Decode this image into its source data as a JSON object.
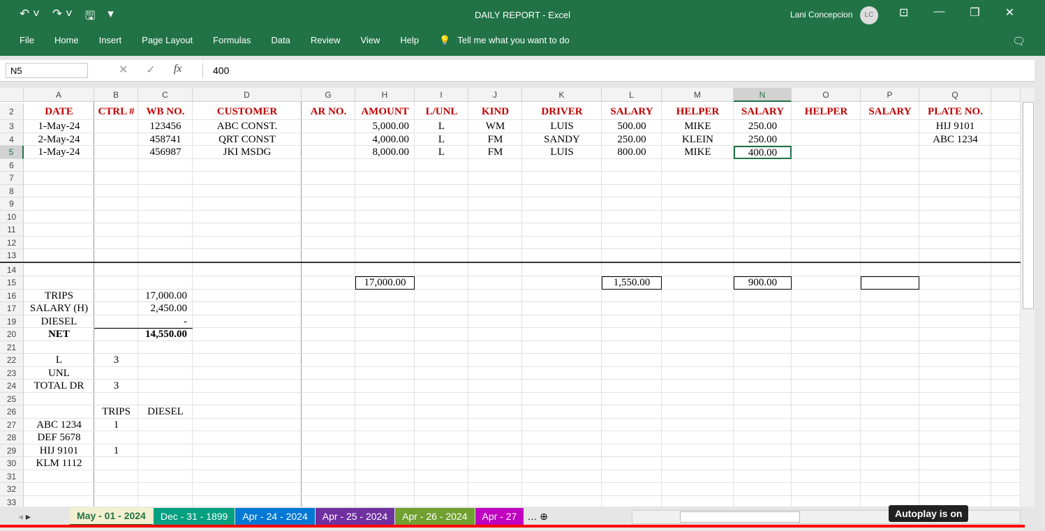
{
  "titlebar": {
    "title": "DAILY REPORT  -  Excel",
    "user": "Lani Concepcion",
    "initials": "LC"
  },
  "menu": [
    "File",
    "Home",
    "Insert",
    "Page Layout",
    "Formulas",
    "Data",
    "Review",
    "View",
    "Help"
  ],
  "tell_me": "Tell me what you want to do",
  "formula_bar": {
    "name_box": "N5",
    "value": "400"
  },
  "columns": [
    [
      "A",
      101
    ],
    [
      "B",
      63
    ],
    [
      "C",
      78
    ],
    [
      "D",
      156
    ],
    [
      "G",
      77
    ],
    [
      "H",
      85
    ],
    [
      "I",
      77
    ],
    [
      "J",
      77
    ],
    [
      "K",
      114
    ],
    [
      "L",
      86
    ],
    [
      "M",
      103
    ],
    [
      "N",
      83
    ],
    [
      "O",
      99
    ],
    [
      "P",
      84
    ],
    [
      "Q",
      103
    ],
    [
      "",
      42
    ]
  ],
  "selected_col": "N",
  "selected_row": "5",
  "rows": [
    "2",
    "3",
    "4",
    "5",
    "6",
    "7",
    "8",
    "9",
    "10",
    "11",
    "12",
    "13",
    "14",
    "15",
    "16",
    "17",
    "19",
    "20",
    "21",
    "22",
    "23",
    "24",
    "25",
    "26",
    "27",
    "28",
    "29",
    "30",
    "31",
    "32",
    "33"
  ],
  "cells": [
    [
      "2",
      "A",
      "DATE",
      "hdr"
    ],
    [
      "2",
      "B",
      "CTRL #",
      "hdr"
    ],
    [
      "2",
      "C",
      "WB NO.",
      "hdr"
    ],
    [
      "2",
      "D",
      "CUSTOMER",
      "hdr"
    ],
    [
      "2",
      "G",
      "AR NO.",
      "hdr"
    ],
    [
      "2",
      "H",
      "AMOUNT",
      "hdr"
    ],
    [
      "2",
      "I",
      "L/UNL",
      "hdr"
    ],
    [
      "2",
      "J",
      "KIND",
      "hdr"
    ],
    [
      "2",
      "K",
      "DRIVER",
      "hdr"
    ],
    [
      "2",
      "L",
      "SALARY",
      "hdr"
    ],
    [
      "2",
      "M",
      "HELPER",
      "hdr"
    ],
    [
      "2",
      "N",
      "SALARY",
      "hdr"
    ],
    [
      "2",
      "O",
      "HELPER",
      "hdr"
    ],
    [
      "2",
      "P",
      "SALARY",
      "hdr"
    ],
    [
      "2",
      "Q",
      "PLATE NO.",
      "hdr"
    ],
    [
      "3",
      "A",
      "1-May-24",
      ""
    ],
    [
      "3",
      "C",
      "123456",
      ""
    ],
    [
      "3",
      "D",
      "ABC CONST.",
      ""
    ],
    [
      "3",
      "H",
      "5,000.00",
      "r"
    ],
    [
      "3",
      "I",
      "L",
      ""
    ],
    [
      "3",
      "J",
      "WM",
      ""
    ],
    [
      "3",
      "K",
      "LUIS",
      ""
    ],
    [
      "3",
      "L",
      "500.00",
      ""
    ],
    [
      "3",
      "M",
      "MIKE",
      ""
    ],
    [
      "3",
      "N",
      "250.00",
      ""
    ],
    [
      "3",
      "Q",
      "HIJ 9101",
      ""
    ],
    [
      "4",
      "A",
      "2-May-24",
      ""
    ],
    [
      "4",
      "C",
      "458741",
      ""
    ],
    [
      "4",
      "D",
      "QRT CONST",
      ""
    ],
    [
      "4",
      "H",
      "4,000.00",
      "r"
    ],
    [
      "4",
      "I",
      "L",
      ""
    ],
    [
      "4",
      "J",
      "FM",
      ""
    ],
    [
      "4",
      "K",
      "SANDY",
      ""
    ],
    [
      "4",
      "L",
      "250.00",
      ""
    ],
    [
      "4",
      "M",
      "KLEIN",
      ""
    ],
    [
      "4",
      "N",
      "250.00",
      ""
    ],
    [
      "4",
      "Q",
      "ABC 1234",
      ""
    ],
    [
      "5",
      "A",
      "1-May-24",
      ""
    ],
    [
      "5",
      "C",
      "456987",
      ""
    ],
    [
      "5",
      "D",
      "JKI MSDG",
      ""
    ],
    [
      "5",
      "H",
      "8,000.00",
      "r"
    ],
    [
      "5",
      "I",
      "L",
      ""
    ],
    [
      "5",
      "J",
      "FM",
      ""
    ],
    [
      "5",
      "K",
      "LUIS",
      ""
    ],
    [
      "5",
      "L",
      "800.00",
      ""
    ],
    [
      "5",
      "M",
      "MIKE",
      ""
    ],
    [
      "5",
      "N",
      "400.00",
      "selc"
    ],
    [
      "15",
      "H",
      "17,000.00",
      "box"
    ],
    [
      "15",
      "L",
      "1,550.00",
      "box"
    ],
    [
      "15",
      "N",
      "900.00",
      "box"
    ],
    [
      "15",
      "P",
      "",
      "box"
    ],
    [
      "16",
      "A",
      "TRIPS",
      ""
    ],
    [
      "16",
      "C",
      "17,000.00",
      "r"
    ],
    [
      "17",
      "A",
      "SALARY (H)",
      ""
    ],
    [
      "17",
      "C",
      "2,450.00",
      "r"
    ],
    [
      "19",
      "A",
      "DIESEL",
      ""
    ],
    [
      "19",
      "C",
      "-",
      "r"
    ],
    [
      "20",
      "A",
      "NET",
      "b"
    ],
    [
      "20",
      "C",
      "14,550.00",
      "r b"
    ],
    [
      "22",
      "A",
      "L",
      ""
    ],
    [
      "22",
      "B",
      "3",
      ""
    ],
    [
      "23",
      "A",
      "UNL",
      ""
    ],
    [
      "24",
      "A",
      "TOTAL DR",
      ""
    ],
    [
      "24",
      "B",
      "3",
      ""
    ],
    [
      "26",
      "B",
      "TRIPS",
      ""
    ],
    [
      "26",
      "C",
      "DIESEL",
      ""
    ],
    [
      "27",
      "A",
      "ABC 1234",
      ""
    ],
    [
      "27",
      "B",
      "1",
      ""
    ],
    [
      "28",
      "A",
      "DEF 5678",
      ""
    ],
    [
      "29",
      "A",
      "HIJ 9101",
      ""
    ],
    [
      "29",
      "B",
      "1",
      ""
    ],
    [
      "30",
      "A",
      "KLM 1112",
      ""
    ]
  ],
  "sheet_tabs": [
    {
      "label": "May - 01 - 2024",
      "color": "#f3f0d0",
      "active": true
    },
    {
      "label": "Dec - 31 - 1899",
      "color": "#00a080"
    },
    {
      "label": "Apr - 24 - 2024",
      "color": "#0078d4"
    },
    {
      "label": "Apr - 25 - 2024",
      "color": "#7030a0"
    },
    {
      "label": "Apr - 26 - 2024",
      "color": "#70a030"
    },
    {
      "label": "Apr - 27",
      "color": "#c000c0"
    }
  ],
  "overlay": {
    "autoplay": "Autoplay is on"
  }
}
